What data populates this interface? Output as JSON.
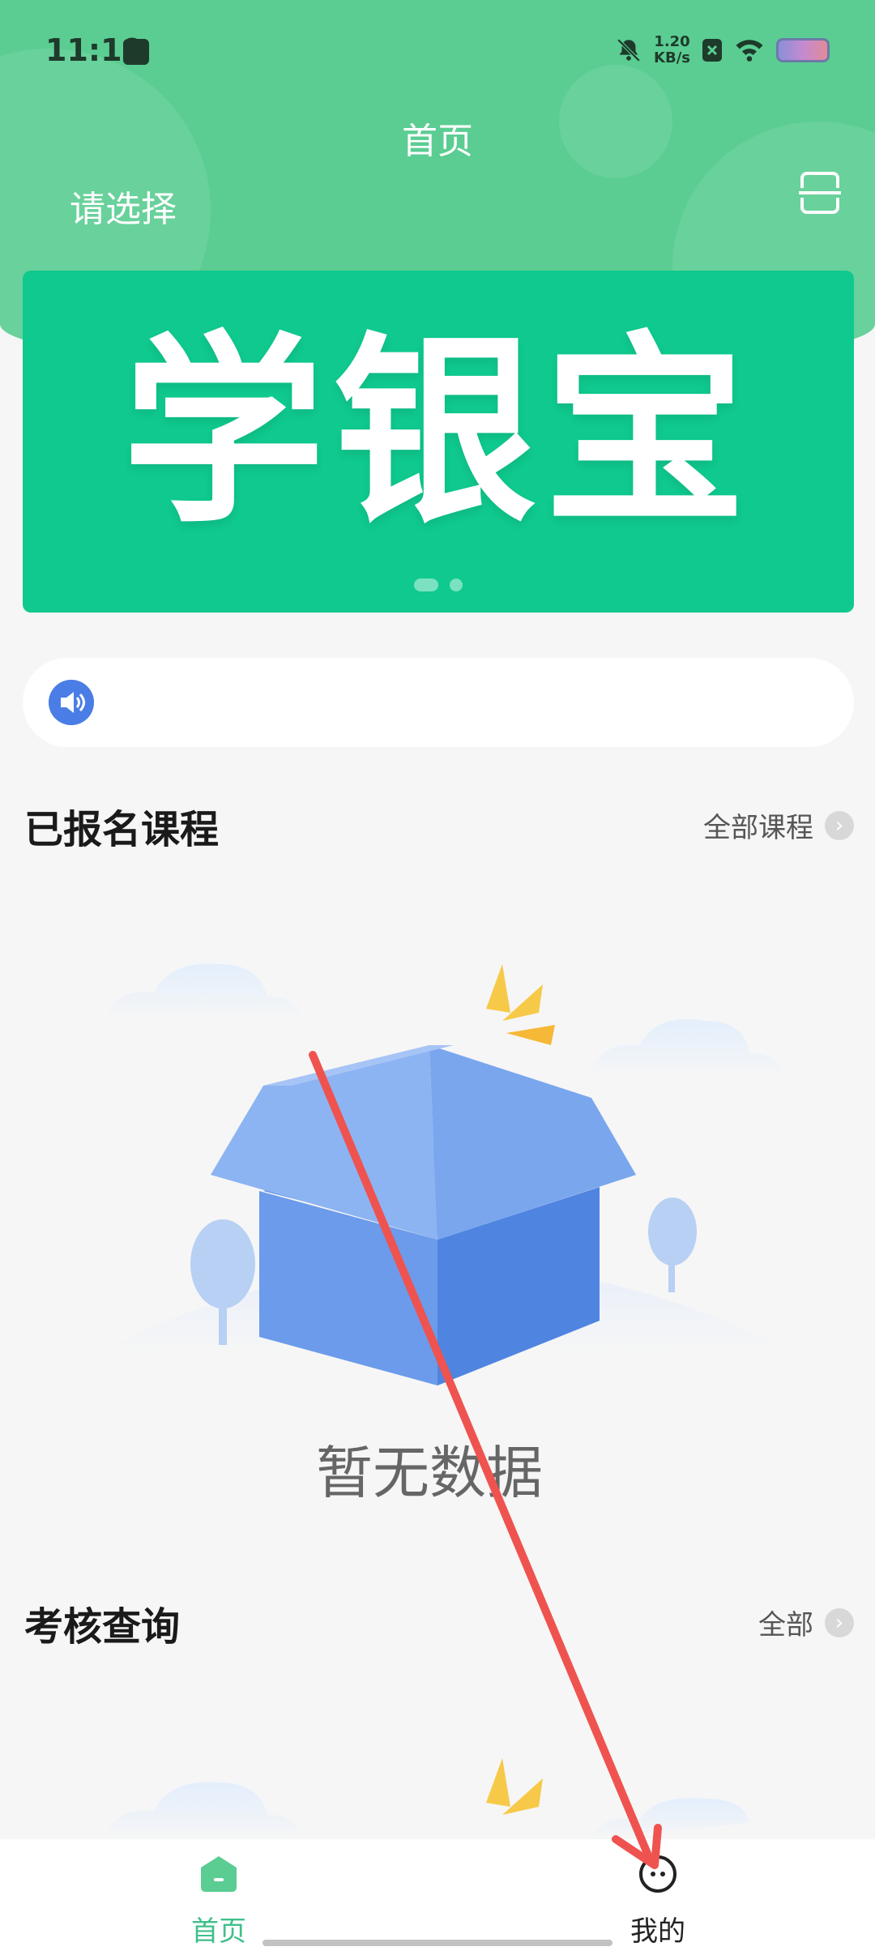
{
  "status_bar": {
    "time": "11:19",
    "net_speed_value": "1.20",
    "net_speed_unit": "KB/s",
    "icons": [
      "mute-bell-icon",
      "close-app-icon",
      "wifi-icon",
      "battery-icon"
    ]
  },
  "header": {
    "title": "首页",
    "select_label": "请选择",
    "scan_icon": "scan-icon"
  },
  "banner": {
    "text": "学银宝",
    "slide_count": 2,
    "active_slide": 1,
    "background": "#0fc98e"
  },
  "notice": {
    "icon": "speaker-icon",
    "text": ""
  },
  "enrolled_courses": {
    "title": "已报名课程",
    "more_label": "全部课程",
    "empty_text": "暂无数据"
  },
  "exam_query": {
    "title": "考核查询",
    "more_label": "全部"
  },
  "tabbar": {
    "tabs": [
      {
        "label": "首页",
        "icon": "home-icon",
        "active": true
      },
      {
        "label": "我的",
        "icon": "profile-icon",
        "active": false
      }
    ]
  },
  "colors": {
    "brand_green": "#5bcd92",
    "active_tab": "#3fbf8a",
    "annotation_arrow": "#ef5350"
  }
}
